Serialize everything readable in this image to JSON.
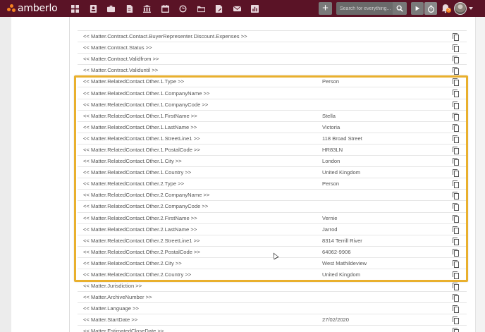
{
  "app": {
    "name": "amberlo"
  },
  "nav_icons": [
    "dashboard-icon",
    "contacts-icon",
    "matters-icon",
    "documents-icon",
    "billing-icon",
    "calendar-icon",
    "history-icon",
    "folder-icon",
    "notes-icon",
    "mail-icon",
    "reports-icon"
  ],
  "search": {
    "placeholder": "Search for everything..."
  },
  "plus_label": "+",
  "notification_count": "5",
  "colors": {
    "topbar": "#5a1326",
    "accent": "#f58220",
    "highlight": "#e9b02e"
  },
  "rows": [
    {
      "name": "<< Matter.Contract.Contact.BuyerRepresenter.Discount.Expenses >>",
      "value": ""
    },
    {
      "name": "<< Matter.Contract.Status >>",
      "value": ""
    },
    {
      "name": "<< Matter.Contract.Validfrom >>",
      "value": ""
    },
    {
      "name": "<< Matter.Contract.Validuntil >>",
      "value": ""
    },
    {
      "name": "<< Matter.RelatedContact.Other.1.Type >>",
      "value": "Person"
    },
    {
      "name": "<< Matter.RelatedContact.Other.1.CompanyName >>",
      "value": ""
    },
    {
      "name": "<< Matter.RelatedContact.Other.1.CompanyCode >>",
      "value": ""
    },
    {
      "name": "<< Matter.RelatedContact.Other.1.FirstName >>",
      "value": "Stella"
    },
    {
      "name": "<< Matter.RelatedContact.Other.1.LastName >>",
      "value": "Victoria"
    },
    {
      "name": "<< Matter.RelatedContact.Other.1.StreetLine1 >>",
      "value": "118 Broad Street"
    },
    {
      "name": "<< Matter.RelatedContact.Other.1.PostalCode >>",
      "value": "HR83LN"
    },
    {
      "name": "<< Matter.RelatedContact.Other.1.City >>",
      "value": "London"
    },
    {
      "name": "<< Matter.RelatedContact.Other.1.Country >>",
      "value": "United Kingdom"
    },
    {
      "name": "<< Matter.RelatedContact.Other.2.Type >>",
      "value": "Person"
    },
    {
      "name": "<< Matter.RelatedContact.Other.2.CompanyName >>",
      "value": ""
    },
    {
      "name": "<< Matter.RelatedContact.Other.2.CompanyCode >>",
      "value": ""
    },
    {
      "name": "<< Matter.RelatedContact.Other.2.FirstName >>",
      "value": "Vernie"
    },
    {
      "name": "<< Matter.RelatedContact.Other.2.LastName >>",
      "value": "Jarrod"
    },
    {
      "name": "<< Matter.RelatedContact.Other.2.StreetLine1 >>",
      "value": "8314 Terrill River"
    },
    {
      "name": "<< Matter.RelatedContact.Other.2.PostalCode >>",
      "value": "64062-9906"
    },
    {
      "name": "<< Matter.RelatedContact.Other.2.City >>",
      "value": "West Mathildeview"
    },
    {
      "name": "<< Matter.RelatedContact.Other.2.Country >>",
      "value": "United Kingdom"
    },
    {
      "name": "<< Matter.Jurisdiction >>",
      "value": ""
    },
    {
      "name": "<< Matter.ArchiveNumber >>",
      "value": ""
    },
    {
      "name": "<< Matter.Language >>",
      "value": ""
    },
    {
      "name": "<< Matter.StartDate >>",
      "value": "27/02/2020"
    },
    {
      "name": "<< Matter.EstimatedCloseDate >>",
      "value": ""
    }
  ]
}
